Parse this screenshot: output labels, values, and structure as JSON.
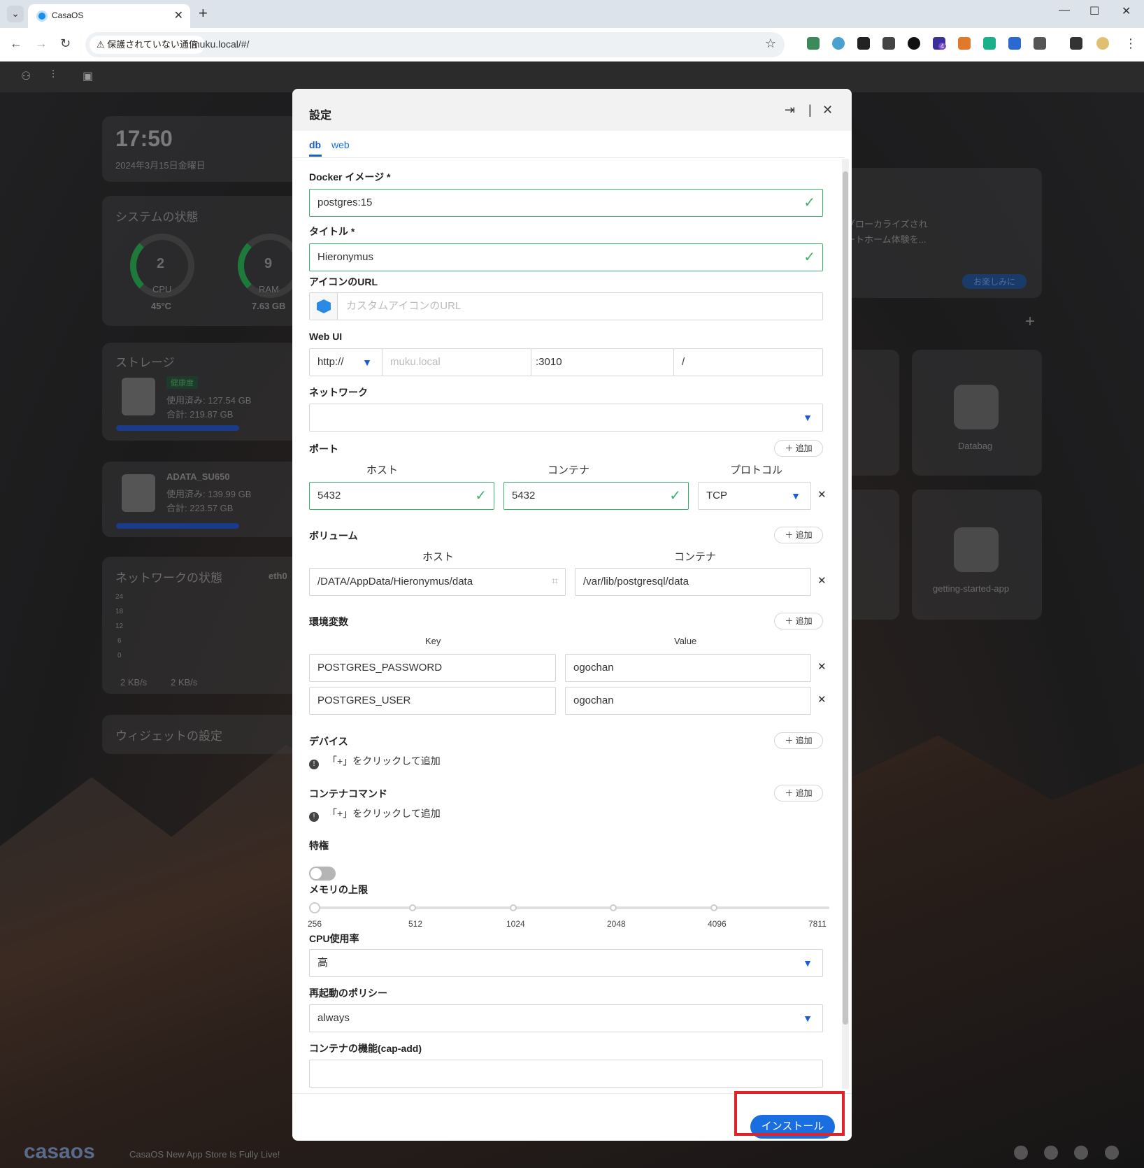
{
  "browser": {
    "tab_title": "CasaOS",
    "security_warning": "保護されていない通信",
    "url": "muku.local/#/",
    "extension_badge": "4"
  },
  "background": {
    "time": "17:50",
    "date": "2024年3月15日金曜日",
    "system_title": "システムの状態",
    "cpu_value": "2",
    "cpu_label": "CPU",
    "cpu_temp": "45°C",
    "ram_value": "9",
    "ram_label": "RAM",
    "ram_total": "7.63 GB",
    "storage_title": "ストレージ",
    "storage_badge": "健康度",
    "storage1_used": "使用済み: 127.54 GB",
    "storage1_total": "合計: 219.87 GB",
    "storage2_name": "ADATA_SU650",
    "storage2_used": "使用済み: 139.99 GB",
    "storage2_total": "合計: 223.57 GB",
    "network_title": "ネットワークの状態",
    "network_iface": "eth0",
    "network_ticks": [
      "24",
      "18",
      "12",
      "6",
      "0"
    ],
    "net_down": "2 KB/s",
    "net_up": "2 KB/s",
    "widget_settings": "ウィジェットの設定",
    "promo_text_1": "グローカライズされ",
    "promo_text_2": "ートホーム体験を...",
    "promo_button": "お楽しみに",
    "app1": "Databag",
    "app2": "getting-started-app",
    "footer_text": "CasaOS New App Store Is Fully Live!",
    "logo_text": "casaos"
  },
  "modal": {
    "title": "設定",
    "tabs": [
      "db",
      "web"
    ],
    "docker_image_label": "Docker イメージ *",
    "docker_image_value": "postgres:15",
    "title_label": "タイトル *",
    "title_value": "Hieronymus",
    "icon_url_label": "アイコンのURL",
    "icon_url_placeholder": "カスタムアイコンのURL",
    "webui_label": "Web UI",
    "webui_scheme": "http://",
    "webui_host_placeholder": "muku.local",
    "webui_port": ":3010",
    "webui_path": "/",
    "network_label": "ネットワーク",
    "network_value": "",
    "ports_label": "ポート",
    "ports_headers": [
      "ホスト",
      "コンテナ",
      "プロトコル"
    ],
    "port_host": "5432",
    "port_container": "5432",
    "port_protocol": "TCP",
    "volumes_label": "ボリューム",
    "volumes_headers": [
      "ホスト",
      "コンテナ"
    ],
    "volume_host": "/DATA/AppData/Hieronymus/data",
    "volume_container": "/var/lib/postgresql/data",
    "env_label": "環境変数",
    "env_headers": [
      "Key",
      "Value"
    ],
    "env": [
      {
        "key": "POSTGRES_PASSWORD",
        "value": "ogochan"
      },
      {
        "key": "POSTGRES_USER",
        "value": "ogochan"
      }
    ],
    "devices_label": "デバイス",
    "devices_note": "「+」をクリックして追加",
    "command_label": "コンテナコマンド",
    "command_note": "「+」をクリックして追加",
    "privileged_label": "特権",
    "privileged_on": false,
    "memory_label": "メモリの上限",
    "memory_ticks": [
      "256",
      "512",
      "1024",
      "2048",
      "4096",
      "7811"
    ],
    "memory_value": "256",
    "cpu_label": "CPU使用率",
    "cpu_value": "高",
    "restart_label": "再起動のポリシー",
    "restart_value": "always",
    "capadd_label": "コンテナの機能(cap-add)",
    "capadd_value": "",
    "add_label": "追加",
    "install_label": "インストール"
  },
  "colors": {
    "accent": "#1a6fe0",
    "valid": "#3fae6f",
    "highlight": "#e0232b"
  }
}
